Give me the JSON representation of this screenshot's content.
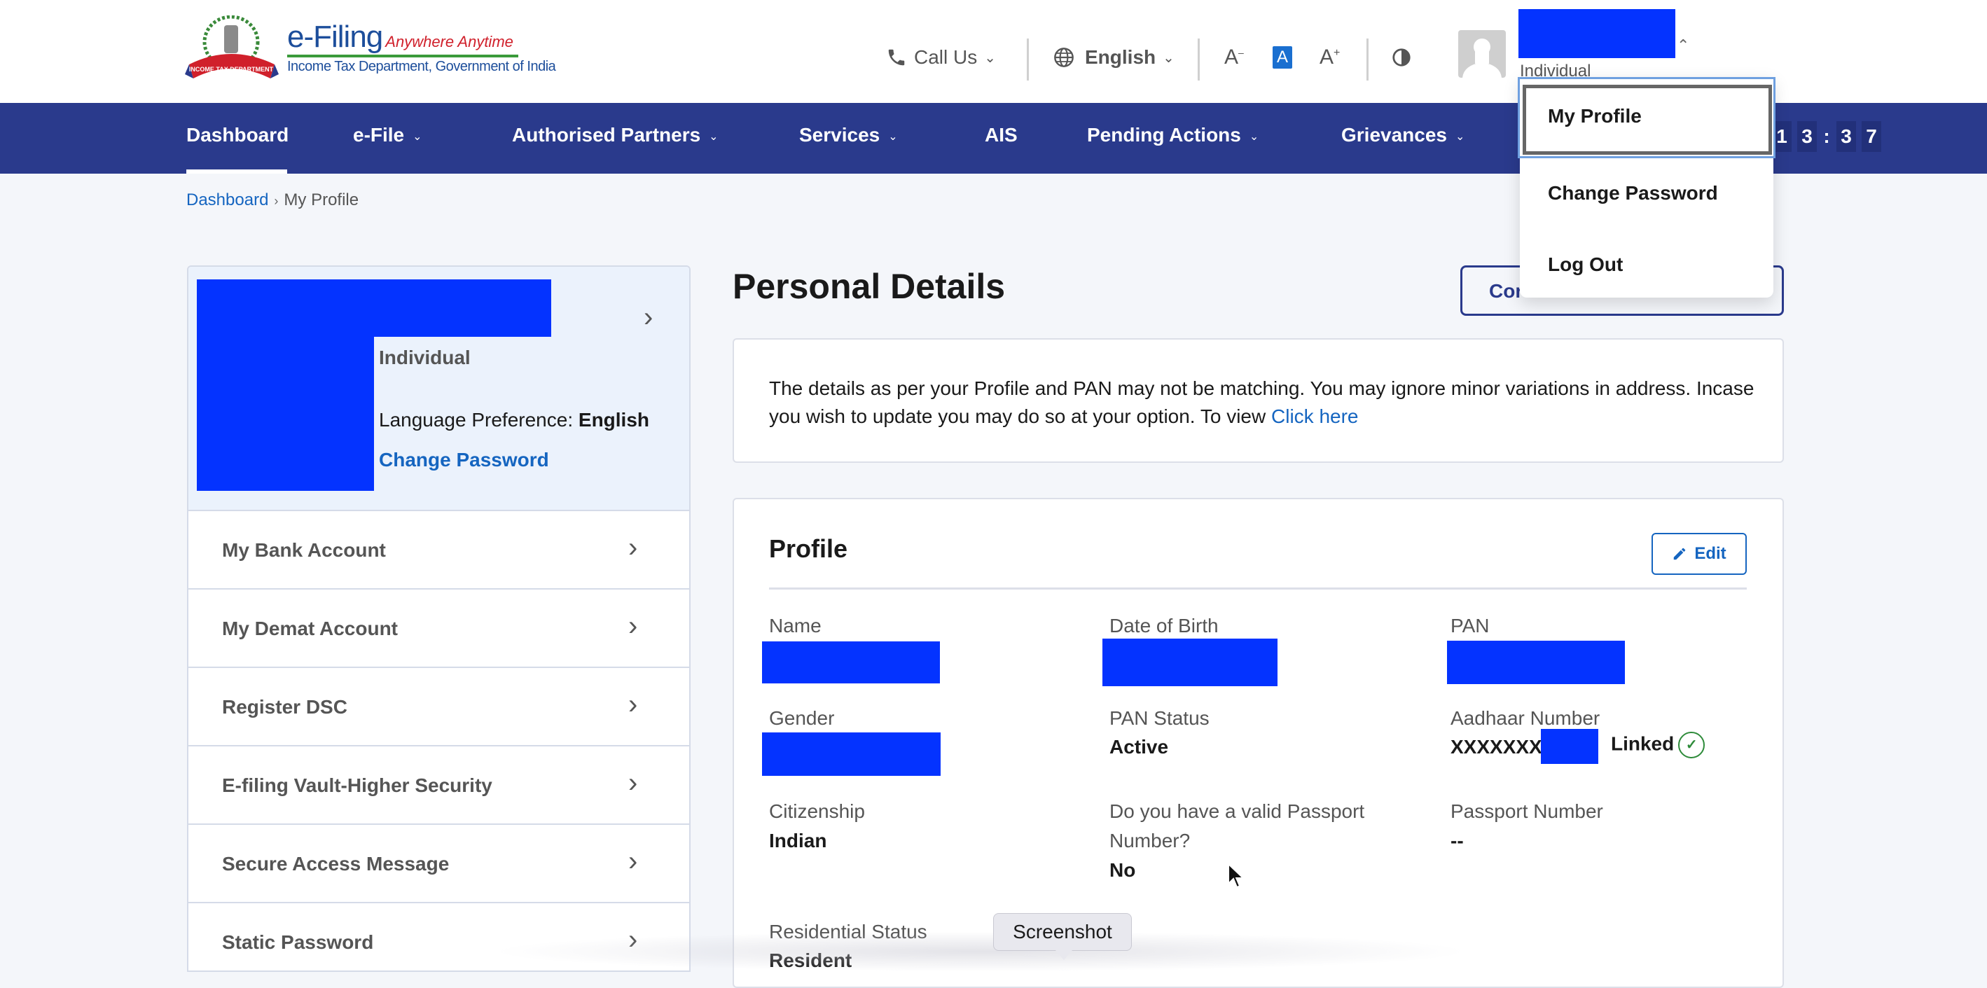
{
  "header": {
    "logo_title": "e-Filing",
    "logo_tagline": "Anywhere Anytime",
    "logo_subtitle": "Income Tax Department, Government of India",
    "emblem_ribbon": "INCOME TAX DEPARTMENT",
    "call_us": "Call Us",
    "language": "English",
    "user_type": "Individual",
    "icons": [
      "phone-icon",
      "globe-icon",
      "font-decrease-icon",
      "font-normal-icon",
      "font-increase-icon",
      "contrast-icon",
      "avatar-icon"
    ]
  },
  "nav": {
    "items": [
      {
        "label": "Dashboard",
        "dropdown": false,
        "active": true
      },
      {
        "label": "e-File",
        "dropdown": true
      },
      {
        "label": "Authorised Partners",
        "dropdown": true
      },
      {
        "label": "Services",
        "dropdown": true
      },
      {
        "label": "AIS",
        "dropdown": false
      },
      {
        "label": "Pending Actions",
        "dropdown": true
      },
      {
        "label": "Grievances",
        "dropdown": true
      }
    ],
    "timer_digits": [
      "1",
      "3",
      "3",
      "7"
    ],
    "timer_separator": ":"
  },
  "user_menu": {
    "items": [
      "My Profile",
      "Change Password",
      "Log Out"
    ],
    "focused": "My Profile"
  },
  "breadcrumb": {
    "items": [
      "Dashboard",
      "My Profile"
    ],
    "separator": "›"
  },
  "profile_card": {
    "user_type": "Individual",
    "language_label": "Language Preference:",
    "language_value": "English",
    "change_password": "Change Password"
  },
  "side_menu": [
    "My Bank Account",
    "My Demat Account",
    "Register DSC",
    "E-filing Vault-Higher Security",
    "Secure Access Message",
    "Static Password"
  ],
  "main": {
    "title": "Personal Details",
    "comp_button_visible": "Cor",
    "notice_text": "The details as per your Profile and PAN may not be matching. You may ignore minor variations in address. Incase you wish to update you may do so at your option. To view ",
    "notice_link": "Click here",
    "profile": {
      "title": "Profile",
      "edit_label": "Edit",
      "fields": {
        "name_label": "Name",
        "dob_label": "Date of Birth",
        "pan_label": "PAN",
        "gender_label": "Gender",
        "pan_status_label": "PAN Status",
        "pan_status_value": "Active",
        "aadhaar_label": "Aadhaar Number",
        "aadhaar_prefix": "XXXXXXX",
        "aadhaar_status": "Linked",
        "citizenship_label": "Citizenship",
        "citizenship_value": "Indian",
        "passport_q_label": "Do you have a valid Passport Number?",
        "passport_q_value": "No",
        "passport_number_label": "Passport Number",
        "passport_number_value": "--",
        "residential_label": "Residential Status",
        "residential_value": "Resident"
      }
    }
  },
  "tooltip": "Screenshot",
  "colors": {
    "nav_bg": "#2a3a8c",
    "link": "#1565c0",
    "redaction": "#0433ff",
    "linked_green": "#2e8b3a",
    "page_bg": "#f4f6fa"
  }
}
